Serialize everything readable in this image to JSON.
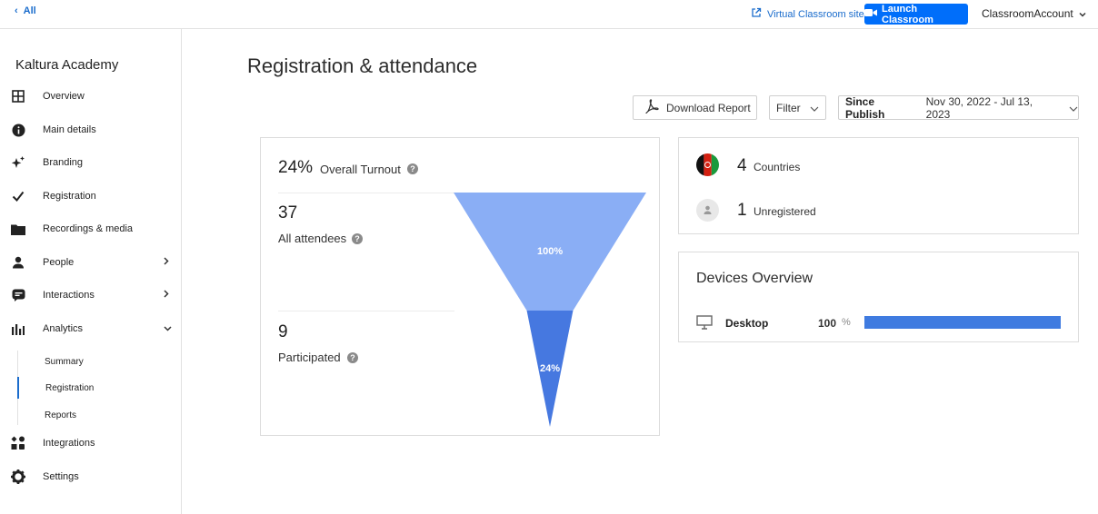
{
  "topbar": {
    "back_label": "All",
    "virtual_classroom_label": "Virtual Classroom site",
    "launch_label": "Launch Classroom",
    "account_label": "ClassroomAccount"
  },
  "sidebar": {
    "brand": "Kaltura Academy",
    "items": [
      {
        "label": "Overview",
        "icon": "grid-icon"
      },
      {
        "label": "Main details",
        "icon": "info-icon"
      },
      {
        "label": "Branding",
        "icon": "sparkle-icon"
      },
      {
        "label": "Registration",
        "icon": "check-icon"
      },
      {
        "label": "Recordings & media",
        "icon": "folder-icon"
      },
      {
        "label": "People",
        "icon": "person-icon"
      },
      {
        "label": "Interactions",
        "icon": "chat-icon"
      },
      {
        "label": "Analytics",
        "icon": "bar-chart-icon"
      },
      {
        "label": "Integrations",
        "icon": "apps-icon"
      },
      {
        "label": "Settings",
        "icon": "gear-icon"
      }
    ],
    "analytics_sub": [
      "Summary",
      "Registration",
      "Reports"
    ],
    "active_sub": "Registration"
  },
  "main": {
    "title": "Registration & attendance",
    "download_label": "Download Report",
    "filter_label": "Filter",
    "since_label": "Since Publish",
    "date_range": "Nov 30, 2022 - Jul 13, 2023"
  },
  "funnel": {
    "turnout_value": "24%",
    "turnout_label": "Overall Turnout",
    "attendees_value": "37",
    "attendees_label": "All attendees",
    "participated_value": "9",
    "participated_label": "Participated",
    "top_pct_label": "100%",
    "bottom_pct_label": "24%",
    "top_fraction": 1.0,
    "bottom_fraction": 0.24,
    "colors": {
      "top": "#8aaef5",
      "bottom": "#4678e0"
    }
  },
  "summary": {
    "countries_value": "4",
    "countries_label": "Countries",
    "unregistered_value": "1",
    "unregistered_label": "Unregistered"
  },
  "devices": {
    "title": "Devices Overview",
    "items": [
      {
        "name": "Desktop",
        "pct": "100",
        "pct_sign": "%",
        "fraction": 1.0
      }
    ]
  },
  "colors": {
    "accent": "#006efa",
    "link": "#1a6ccc",
    "bar": "#3f7be0"
  }
}
